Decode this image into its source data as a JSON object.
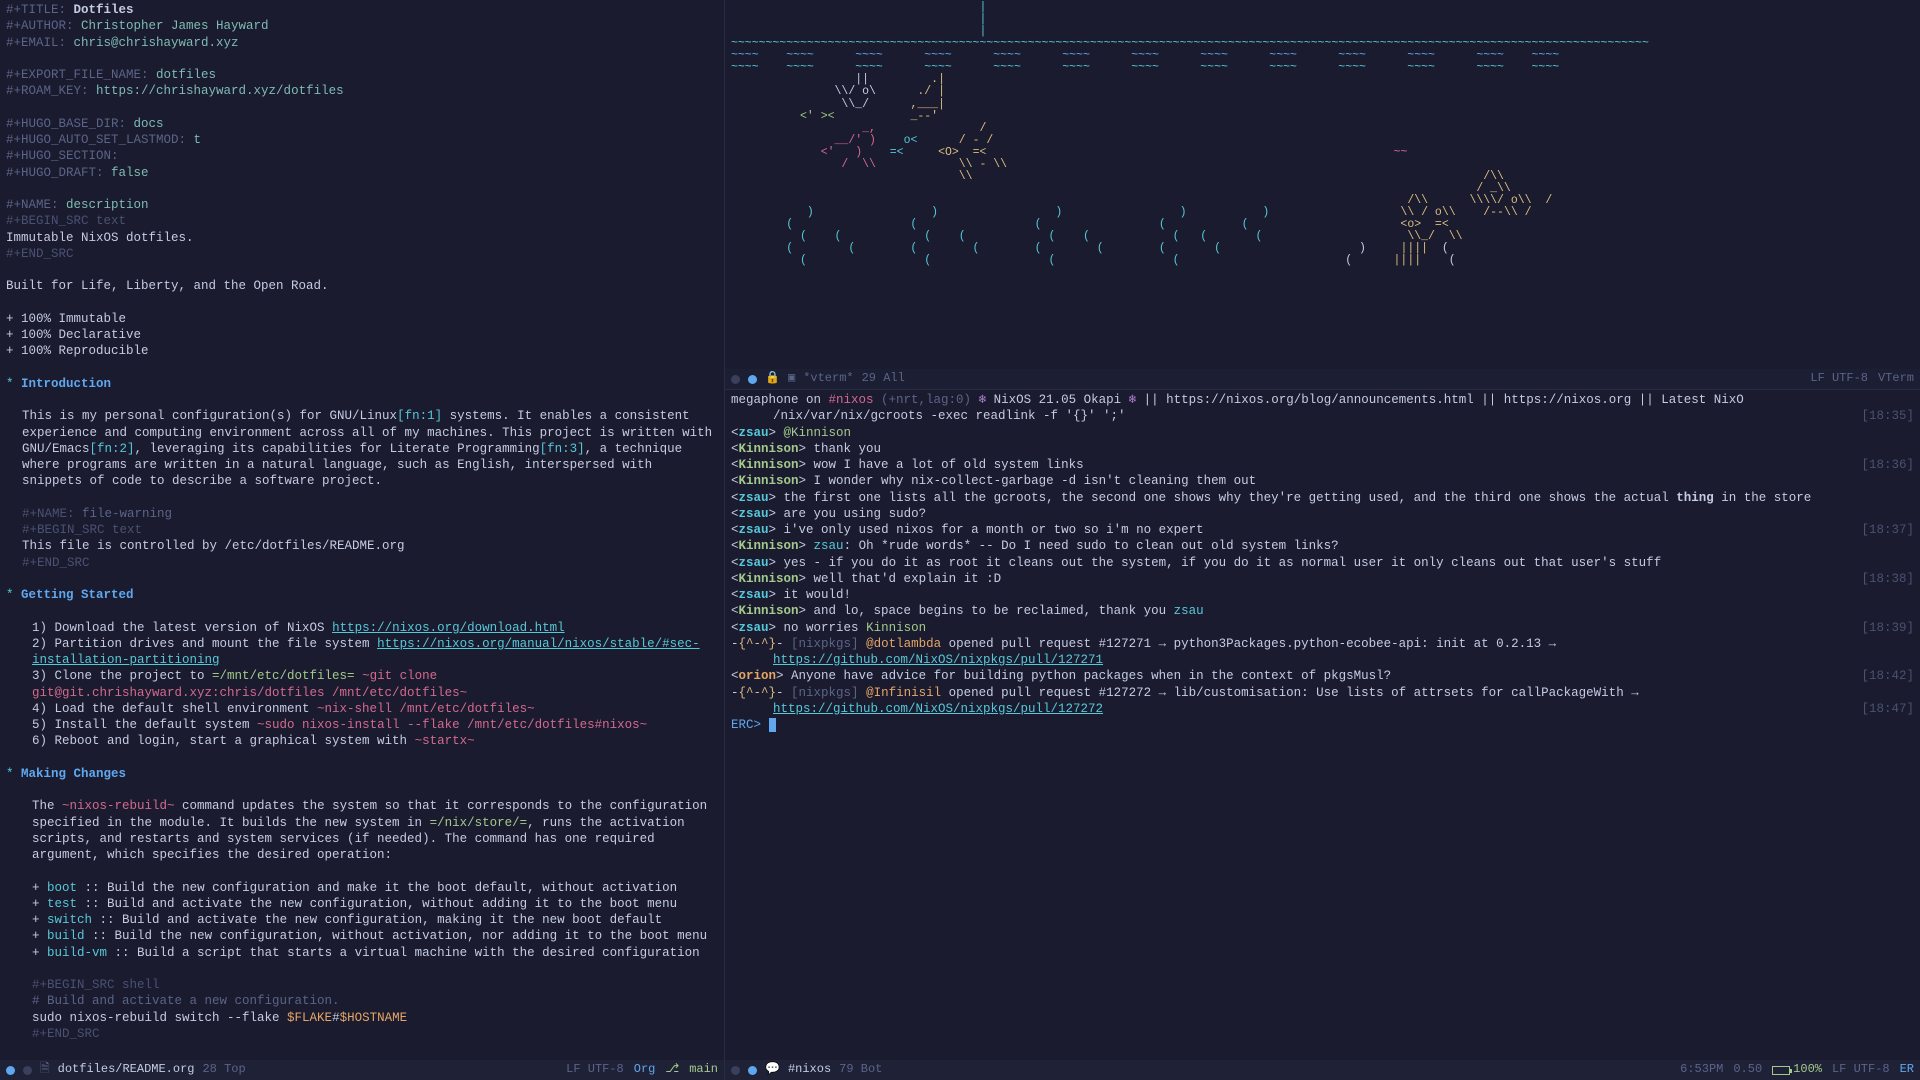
{
  "org": {
    "meta": {
      "title_kw": "#+TITLE:",
      "title": "Dotfiles",
      "author_kw": "#+AUTHOR:",
      "author": "Christopher James Hayward",
      "email_kw": "#+EMAIL:",
      "email": "chris@chrishayward.xyz",
      "export_kw": "#+EXPORT_FILE_NAME:",
      "export": "dotfiles",
      "roam_kw": "#+ROAM_KEY:",
      "roam": "https://chrishayward.xyz/dotfiles",
      "hugo_base_kw": "#+HUGO_BASE_DIR:",
      "hugo_base": "docs",
      "hugo_lastmod_kw": "#+HUGO_AUTO_SET_LASTMOD:",
      "hugo_lastmod": "t",
      "hugo_section_kw": "#+HUGO_SECTION:",
      "hugo_draft_kw": "#+HUGO_DRAFT:",
      "hugo_draft": "false",
      "name_desc_kw": "#+NAME:",
      "name_desc": "description",
      "begin_src_text": "#+BEGIN_SRC text",
      "desc_body": "Immutable NixOS dotfiles.",
      "end_src": "#+END_SRC",
      "tagline": "Built for Life, Liberty, and the Open Road.",
      "bullets": [
        "+ 100% Immutable",
        "+ 100% Declarative",
        "+ 100% Reproducible"
      ],
      "intro_star": "*",
      "intro_h": "Introduction",
      "intro_p1a": "This is my personal configuration(s) for GNU/Linux",
      "fn1": "[fn:1]",
      "intro_p1b": " systems. It enables a consistent experience and computing environment across all of my machines. This project is written with GNU/Emacs",
      "fn2": "[fn:2]",
      "intro_p1c": ", leveraging its capabilities for Literate Programming",
      "fn3": "[fn:3]",
      "intro_p1d": ", a technique where programs are written in a natural language, such as English, interspersed with snippets of code to describe a software project.",
      "name_warn_kw": "#+NAME:",
      "name_warn": "file-warning",
      "warn_body": "This file is controlled by /etc/dotfiles/README.org",
      "gs_h": "Getting Started",
      "gs1a": "1) Download the latest version of NixOS ",
      "gs1b": "https://nixos.org/download.html",
      "gs2a": "2) Partition drives and mount the file system ",
      "gs2b": "https://nixos.org/manual/nixos/stable/#sec-installation-partitioning",
      "gs3a": "3) Clone the project to ",
      "gs3b": "=/mnt/etc/dotfiles=",
      "gs3c": " ~git clone git@git.chrishayward.xyz:chris/dotfiles /mnt/etc/dotfiles~",
      "gs4a": "4) Load the default shell environment ",
      "gs4b": "~nix-shell /mnt/etc/dotfiles~",
      "gs5a": "5) Install the default system ",
      "gs5b": "~sudo nixos-install --flake /mnt/etc/dotfiles#nixos~",
      "gs6a": "6) Reboot and login, start a graphical system with ",
      "gs6b": "~startx~",
      "mc_h": "Making Changes",
      "mc_p1a": "The ",
      "mc_p1b": "~nixos-rebuild~",
      "mc_p1c": " command updates the system so that it corresponds to the configuration specified in the module. It builds the new system in ",
      "mc_p1d": "=/nix/store/=",
      "mc_p1e": ", runs the activation scripts, and restarts and system services (if needed). The command has one required argument, which specifies the desired operation:",
      "ops": [
        {
          "k": "boot",
          "d": ":: Build the new configuration and make it the boot default, without activation"
        },
        {
          "k": "test",
          "d": ":: Build and activate the new configuration, without adding it to the boot menu"
        },
        {
          "k": "switch",
          "d": ":: Build and activate the new configuration, making it the new boot default"
        },
        {
          "k": "build",
          "d": ":: Build the new configuration, without activation, nor adding it to the boot menu"
        },
        {
          "k": "build-vm",
          "d": ":: Build a script that starts a virtual machine with the desired configuration"
        }
      ],
      "begin_src_shell": "#+BEGIN_SRC shell",
      "shell_comment": "# Build and activate a new configuration.",
      "shell_cmd_a": "sudo nixos-rebuild switch --flake ",
      "shell_cmd_b": "$FLAKE",
      "shell_cmd_c": "#",
      "shell_cmd_d": "$HOSTNAME"
    },
    "modeline": {
      "file": "dotfiles/README.org",
      "pos": "28 Top",
      "enc": "LF UTF-8",
      "mode": "Org",
      "branch": "main"
    }
  },
  "vterm": {
    "modeline": {
      "buf": "*vterm*",
      "pos": "29 All",
      "enc": "LF UTF-8",
      "mode": "VTerm"
    }
  },
  "erc": {
    "topic_a": "megaphone on ",
    "topic_chan": "#nixos",
    "topic_b": " (+nrt,lag:0) ",
    "topic_c": " NixOS 21.05 Okapi ",
    "topic_d": " || https://nixos.org/blog/announcements.html || https://nixos.org || Latest NixO",
    "topic_e": "/nix/var/nix/gcroots -exec readlink -f '{}' ';'",
    "ts1": "[18:35]",
    "m1_n": "zsau",
    "m1_t": "@Kinnison",
    "m2_n": "Kinnison",
    "m2_t": "thank you",
    "m3_n": "Kinnison",
    "m3_t": "wow I have a lot of old system links",
    "ts2": "[18:36]",
    "m4_n": "Kinnison",
    "m4_t": "I wonder why nix-collect-garbage -d isn't cleaning them out",
    "m5_n": "zsau",
    "m5_t1": "the first one lists all the gcroots, the second one shows why they're getting used, and the third one shows the actual ",
    "m5_t2": "thing",
    "m5_t3": " in the store",
    "m6_n": "zsau",
    "m6_t": "are you using sudo?",
    "m7_n": "zsau",
    "m7_t": "i've only used nixos for a month or two so i'm no expert",
    "ts3": "[18:37]",
    "m8_n": "Kinnison",
    "m8_t1": "zsau",
    "m8_t2": ": Oh *rude words* -- Do I need sudo to clean out old system links?",
    "m9_n": "zsau",
    "m9_t": "yes - if you do it as root it cleans out the system, if you do it as normal user it only cleans out that user's stuff",
    "m10_n": "Kinnison",
    "m10_t": "well that'd explain it :D",
    "ts4": "[18:38]",
    "m11_n": "zsau",
    "m11_t": "it would!",
    "m12_n": "Kinnison",
    "m12_t1": "and lo, space begins to be reclaimed, thank you ",
    "m12_t2": "zsau",
    "m13_n": "zsau",
    "m13_t1": "no worries ",
    "m13_t2": "Kinnison",
    "ts5": "[18:39]",
    "m14_n": "{^-^}",
    "m14_t1": "[nixpkgs] ",
    "m14_t2": "@dotlambda",
    "m14_t3": " opened pull request #127271 → python3Packages.python-ecobee-api: init at 0.2.13 → ",
    "m14_url": "https://github.com/NixOS/nixpkgs/pull/127271",
    "m15_n": "orion",
    "m15_t": "Anyone have advice for building python packages when in the context of pkgsMusl?",
    "ts6": "[18:42]",
    "m16_n": "{^-^}",
    "m16_t1": "[nixpkgs] ",
    "m16_t2": "@Infinisil",
    "m16_t3": " opened pull request #127272 → lib/customisation: Use lists of attrsets for callPackageWith → ",
    "m16_url": "https://github.com/NixOS/nixpkgs/pull/127272",
    "ts7": "[18:47]",
    "prompt": "ERC>",
    "modeline": {
      "chan": "#nixos",
      "pos": "79 Bot",
      "time": "6:53PM",
      "load": "0.50",
      "bat": "100%",
      "enc": "LF UTF-8",
      "mode": "ER"
    }
  }
}
